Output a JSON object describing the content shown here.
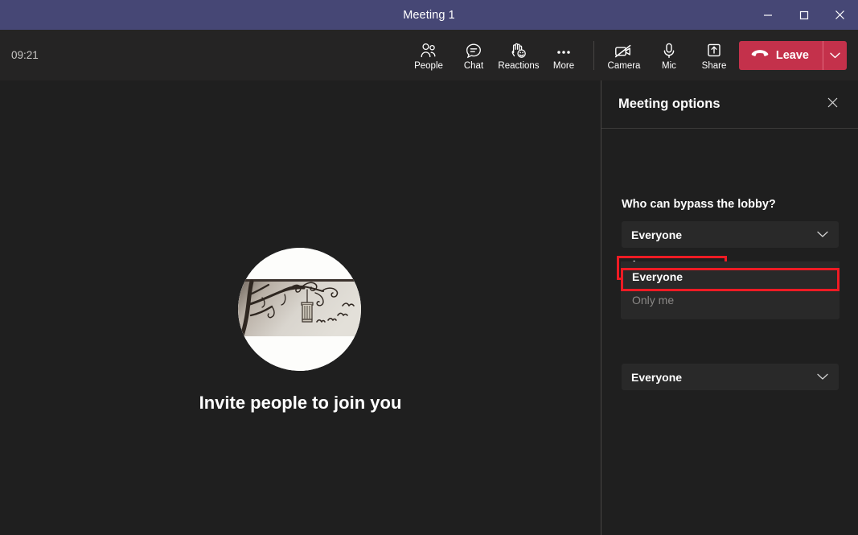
{
  "window": {
    "title": "Meeting 1",
    "controls": {
      "minimize": "Minimize",
      "maximize": "Maximize",
      "close": "Close"
    },
    "titlebar_color": "#464775"
  },
  "toolbar": {
    "timer": "09:21",
    "items": [
      {
        "label": "People",
        "icon": "people-icon"
      },
      {
        "label": "Chat",
        "icon": "chat-icon"
      },
      {
        "label": "Reactions",
        "icon": "reactions-icon"
      },
      {
        "label": "More",
        "icon": "more-ellipsis-icon"
      },
      {
        "label": "Camera",
        "icon": "camera-off-icon"
      },
      {
        "label": "Mic",
        "icon": "microphone-icon"
      },
      {
        "label": "Share",
        "icon": "share-tray-icon"
      }
    ],
    "leave": {
      "label": "Leave",
      "icon": "hangup-phone-icon",
      "caret_icon": "chevron-down-icon",
      "color": "#c4314b"
    }
  },
  "stage": {
    "invite_text": "Invite people to join you",
    "avatar": "user-avatar-tree-birdcage-photo"
  },
  "panel": {
    "title": "Meeting options",
    "close_icon": "close-icon",
    "fields": [
      {
        "label": "Who can bypass the lobby?",
        "value": "Everyone",
        "chevron": "chevron-down-icon",
        "highlighted": false
      },
      {
        "label": "Who can present?",
        "value": "Everyone",
        "chevron": "chevron-down-icon",
        "highlighted": true,
        "expanded": true,
        "options": [
          {
            "label": "Everyone",
            "state": "selected"
          },
          {
            "label": "Only me",
            "state": "disabled"
          }
        ]
      }
    ],
    "highlight_color": "#ee1b24"
  }
}
